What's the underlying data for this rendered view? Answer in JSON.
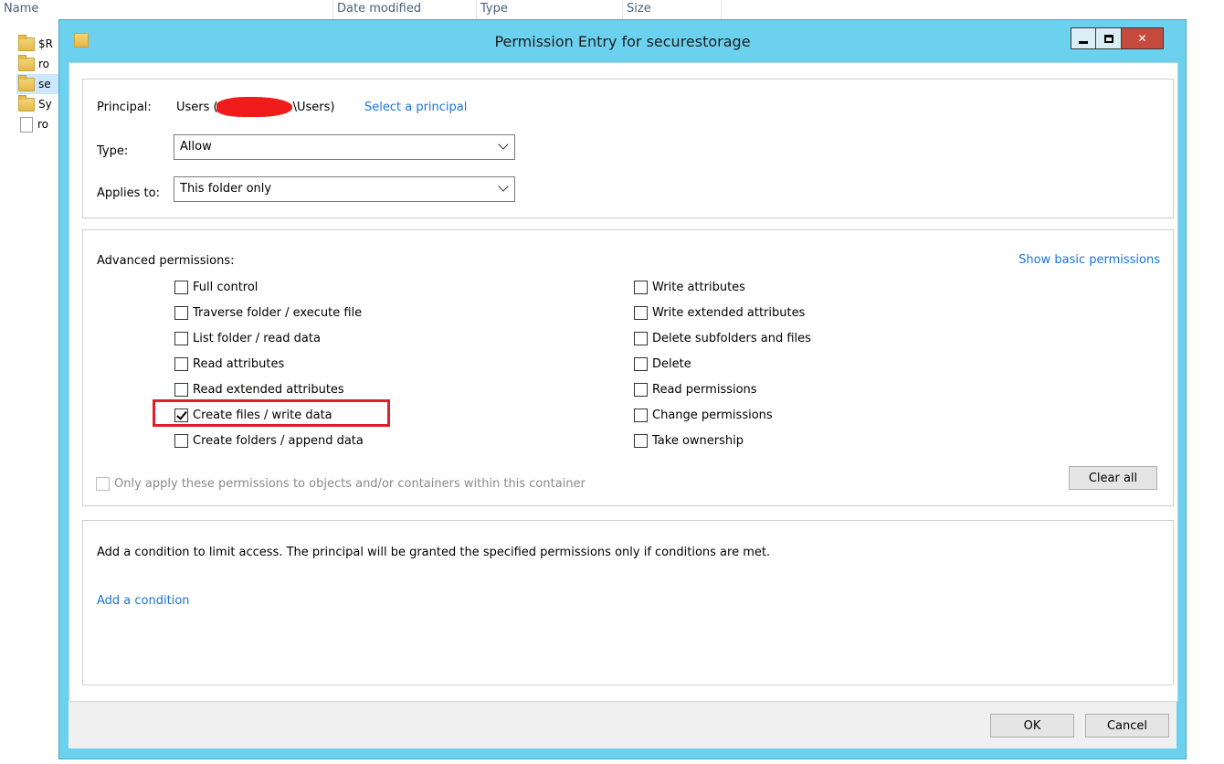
{
  "explorer": {
    "columns": [
      "Name",
      "Date modified",
      "Type",
      "Size"
    ],
    "rows": [
      {
        "name": "$R",
        "kind": "folder"
      },
      {
        "name": "ro",
        "kind": "folder"
      },
      {
        "name": "se",
        "kind": "folder"
      },
      {
        "name": "Sy",
        "kind": "folder"
      },
      {
        "name": "ro",
        "kind": "file"
      }
    ]
  },
  "dialog": {
    "title": "Permission Entry for securestorage",
    "principal_label": "Principal:",
    "principal_value_prefix": "Users (",
    "principal_value_suffix": "\\Users)",
    "select_principal_link": "Select a principal",
    "type_label": "Type:",
    "type_value": "Allow",
    "applies_label": "Applies to:",
    "applies_value": "This folder only",
    "advanced_label": "Advanced permissions:",
    "show_basic_link": "Show basic permissions",
    "permissions_left": [
      {
        "label": "Full control",
        "checked": false
      },
      {
        "label": "Traverse folder / execute file",
        "checked": false
      },
      {
        "label": "List folder / read data",
        "checked": false
      },
      {
        "label": "Read attributes",
        "checked": false
      },
      {
        "label": "Read extended attributes",
        "checked": false
      },
      {
        "label": "Create files / write data",
        "checked": true
      },
      {
        "label": "Create folders / append data",
        "checked": false
      }
    ],
    "permissions_right": [
      {
        "label": "Write attributes",
        "checked": false
      },
      {
        "label": "Write extended attributes",
        "checked": false
      },
      {
        "label": "Delete subfolders and files",
        "checked": false
      },
      {
        "label": "Delete",
        "checked": false
      },
      {
        "label": "Read permissions",
        "checked": false
      },
      {
        "label": "Change permissions",
        "checked": false
      },
      {
        "label": "Take ownership",
        "checked": false
      }
    ],
    "only_apply_label": "Only apply these permissions to objects and/or containers within this container",
    "clear_all_label": "Clear all",
    "condition_text": "Add a condition to limit access. The principal will be granted the specified permissions only if conditions are met.",
    "add_condition_link": "Add a condition",
    "ok_label": "OK",
    "cancel_label": "Cancel"
  },
  "colors": {
    "frame": "#6cd1ee",
    "link": "#1a73d9",
    "highlight": "#e21d2a",
    "redaction": "#f01c1c"
  }
}
